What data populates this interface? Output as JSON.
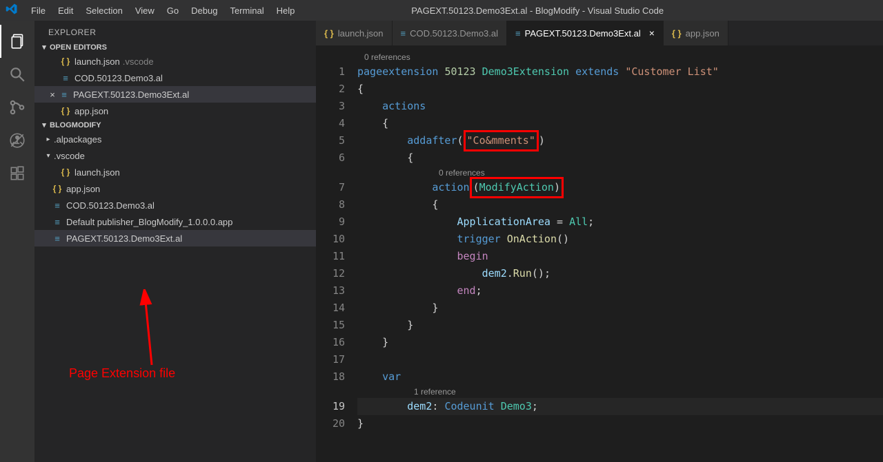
{
  "window": {
    "title": "PAGEXT.50123.Demo3Ext.al - BlogModify - Visual Studio Code"
  },
  "menu": [
    "File",
    "Edit",
    "Selection",
    "View",
    "Go",
    "Debug",
    "Terminal",
    "Help"
  ],
  "sidebar": {
    "title": "EXPLORER",
    "sections": {
      "open_editors": {
        "label": "OPEN EDITORS",
        "items": [
          {
            "name": "launch.json",
            "meta": ".vscode",
            "icon": "json"
          },
          {
            "name": "COD.50123.Demo3.al",
            "icon": "al"
          },
          {
            "name": "PAGEXT.50123.Demo3Ext.al",
            "icon": "al",
            "active": true
          },
          {
            "name": "app.json",
            "icon": "json"
          }
        ]
      },
      "workspace": {
        "label": "BLOGMODIFY",
        "items": [
          {
            "name": ".alpackages",
            "type": "folder",
            "expanded": false
          },
          {
            "name": ".vscode",
            "type": "folder",
            "expanded": true
          },
          {
            "name": "launch.json",
            "type": "file",
            "icon": "json",
            "indent": 2
          },
          {
            "name": "app.json",
            "type": "file",
            "icon": "json"
          },
          {
            "name": "COD.50123.Demo3.al",
            "type": "file",
            "icon": "al"
          },
          {
            "name": "Default publisher_BlogModify_1.0.0.0.app",
            "type": "file",
            "icon": "al"
          },
          {
            "name": "PAGEXT.50123.Demo3Ext.al",
            "type": "file",
            "icon": "al",
            "selected": true
          }
        ]
      }
    }
  },
  "tabs": [
    {
      "label": "launch.json",
      "icon": "json"
    },
    {
      "label": "COD.50123.Demo3.al",
      "icon": "al"
    },
    {
      "label": "PAGEXT.50123.Demo3Ext.al",
      "icon": "al",
      "active": true,
      "closable": true
    },
    {
      "label": "app.json",
      "icon": "json"
    }
  ],
  "editor": {
    "codelens0": "0 references",
    "codelens1": "0 references",
    "codelens2": "1 reference",
    "lines": {
      "l1": {
        "n": "1"
      },
      "l2": {
        "n": "2"
      },
      "l3": {
        "n": "3"
      },
      "l4": {
        "n": "4"
      },
      "l5": {
        "n": "5"
      },
      "l6": {
        "n": "6"
      },
      "l7": {
        "n": "7"
      },
      "l8": {
        "n": "8"
      },
      "l9": {
        "n": "9"
      },
      "l10": {
        "n": "10"
      },
      "l11": {
        "n": "11"
      },
      "l12": {
        "n": "12"
      },
      "l13": {
        "n": "13"
      },
      "l14": {
        "n": "14"
      },
      "l15": {
        "n": "15"
      },
      "l16": {
        "n": "16"
      },
      "l17": {
        "n": "17"
      },
      "l18": {
        "n": "18"
      },
      "l19": {
        "n": "19"
      },
      "l20": {
        "n": "20"
      }
    },
    "tokens": {
      "pageextension": "pageextension",
      "id": "50123",
      "extname": "Demo3Extension",
      "extends": "extends",
      "basename": "\"Customer List\"",
      "lbrace": "{",
      "rbrace": "}",
      "actions": "actions",
      "addafter": "addafter",
      "lparen": "(",
      "rparen": ")",
      "comments": "\"Co&mments\"",
      "action": "action",
      "modifyaction": "ModifyAction",
      "apparea": "ApplicationArea",
      "eq": " = ",
      "all": "All",
      "semi": ";",
      "trigger": "trigger",
      "onaction": "OnAction",
      "begin": "begin",
      "dem2": "dem2",
      "dot": ".",
      "run": "Run",
      "unit": "()",
      "end": "end",
      "var": "var",
      "colon": ": ",
      "codeunit": "Codeunit",
      "demo3": "Demo3"
    }
  },
  "annotation": {
    "label": "Page Extension file"
  }
}
